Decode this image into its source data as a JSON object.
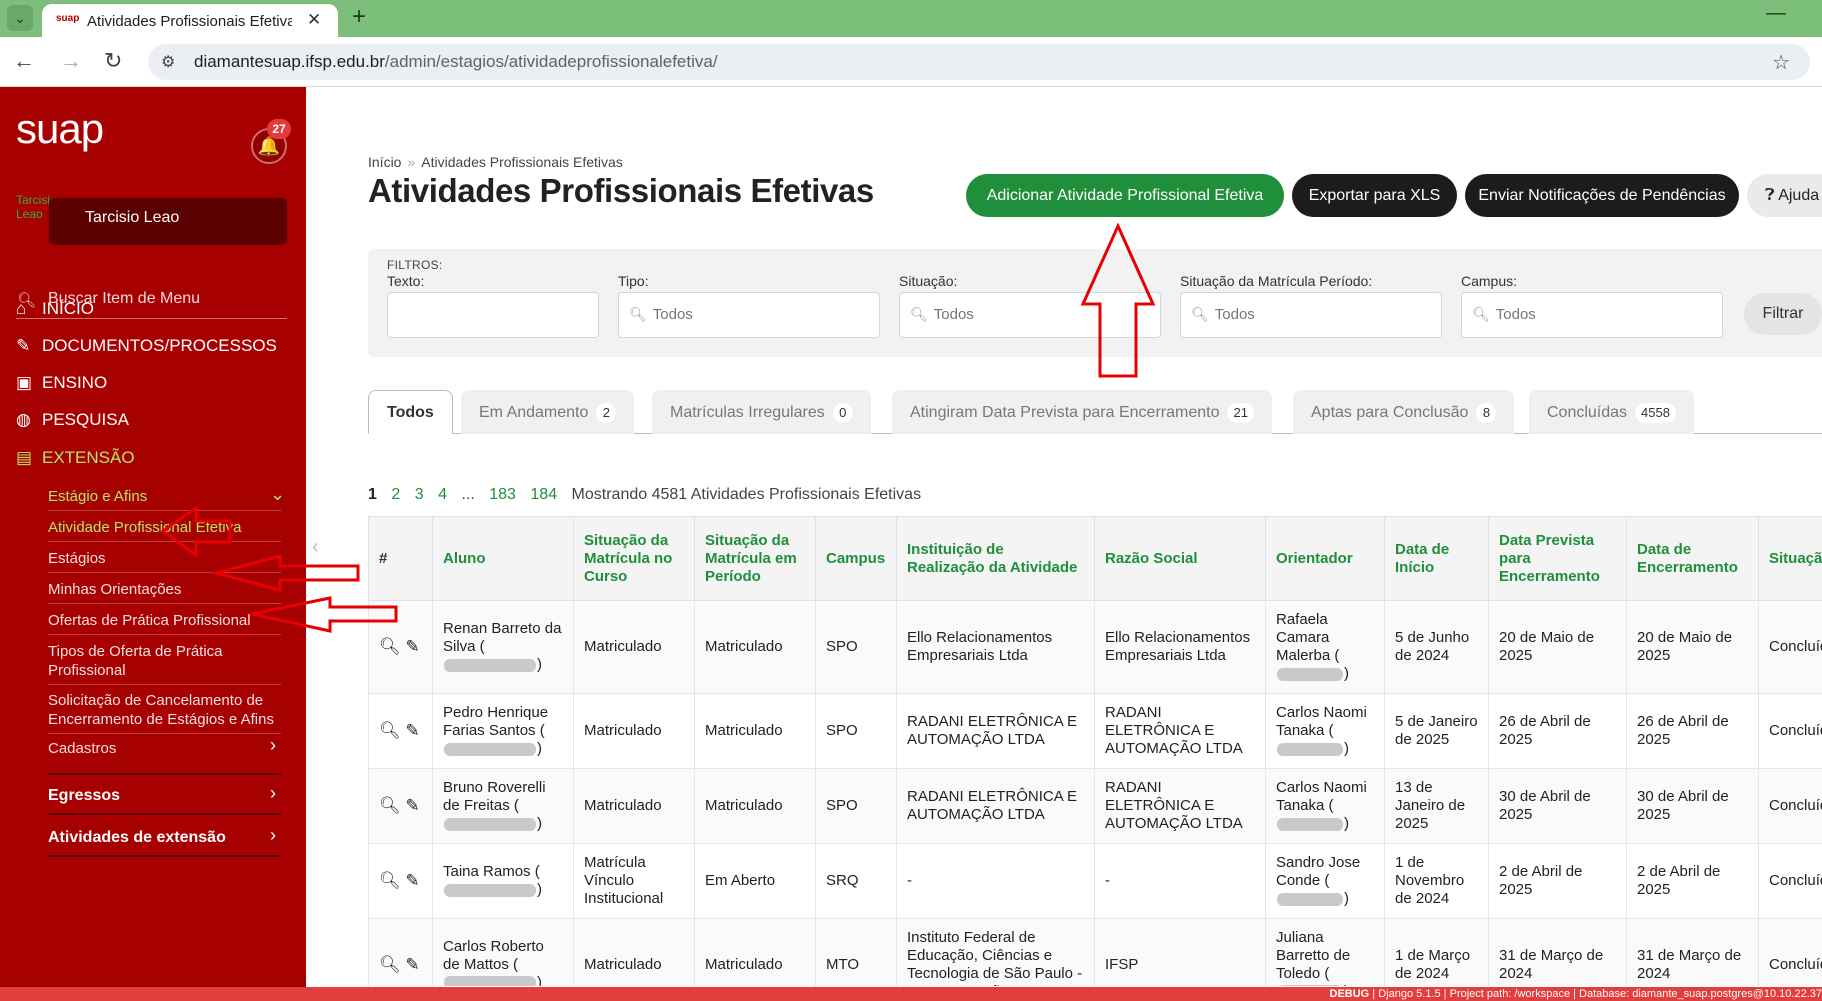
{
  "browser": {
    "tab_title": "Atividades Profissionais Efetivas",
    "tab_favicon_text": "suap",
    "url_host": "diamantesuap.ifsp.edu.br",
    "url_path": "/admin/estagios/atividadeprofissionalefetiva/"
  },
  "sidebar": {
    "logo": "suap",
    "notifications_count": "27",
    "user_name": "Tarcisio Leao",
    "avatar_alt": "Tarcisio Leao",
    "search_placeholder": "Buscar Item de Menu",
    "menu": [
      {
        "label": "INÍCIO",
        "icon": "home-icon"
      },
      {
        "label": "DOCUMENTOS/PROCESSOS",
        "icon": "document-edit-icon"
      },
      {
        "label": "ENSINO",
        "icon": "teacher-icon"
      },
      {
        "label": "PESQUISA",
        "icon": "globe-icon"
      },
      {
        "label": "EXTENSÃO",
        "icon": "briefcase-icon"
      }
    ],
    "submenu_group": "Estágio e Afins",
    "submenu": [
      "Atividade Profissional Efetiva",
      "Estágios",
      "Minhas Orientações",
      "Ofertas de Prática Profissional",
      "Tipos de Oferta de Prática Profissional",
      "Solicitação de Cancelamento de Encerramento de Estágios e Afins",
      "Cadastros"
    ],
    "sections": [
      "Egressos",
      "Atividades de extensão"
    ]
  },
  "main": {
    "breadcrumb": [
      "Início",
      "Atividades Profissionais Efetivas"
    ],
    "title": "Atividades Profissionais Efetivas",
    "buttons": {
      "add": "Adicionar Atividade Profissional Efetiva",
      "export": "Exportar para XLS",
      "notify": "Enviar Notificações de Pendências",
      "help": "Ajuda"
    },
    "filters": {
      "title": "FILTROS:",
      "texto_label": "Texto:",
      "tipo_label": "Tipo:",
      "situacao_label": "Situação:",
      "situacao_matricula_label": "Situação da Matrícula Período:",
      "campus_label": "Campus:",
      "all": "Todos",
      "submit": "Filtrar"
    },
    "tabs": [
      {
        "label": "Todos",
        "count": ""
      },
      {
        "label": "Em Andamento",
        "count": "2"
      },
      {
        "label": "Matrículas Irregulares",
        "count": "0"
      },
      {
        "label": "Atingiram Data Prevista para Encerramento",
        "count": "21"
      },
      {
        "label": "Aptas para Conclusão",
        "count": "8"
      },
      {
        "label": "Concluídas",
        "count": "4558"
      }
    ],
    "pagination": {
      "current": "1",
      "pages": [
        "2",
        "3",
        "4"
      ],
      "ellipsis": "...",
      "last_pages": [
        "183",
        "184"
      ],
      "summary": "Mostrando 4581 Atividades Profissionais Efetivas"
    },
    "table": {
      "headers": [
        "#",
        "Aluno",
        "Situação da Matrícula no Curso",
        "Situação da Matrícula em Período",
        "Campus",
        "Instituição de Realização da Atividade",
        "Razão Social",
        "Orientador",
        "Data de Início",
        "Data Prevista para Encerramento",
        "Data de Encerramento",
        "Situação"
      ],
      "rows": [
        {
          "aluno": "Renan Barreto da Silva",
          "sit_curso": "Matriculado",
          "sit_periodo": "Matriculado",
          "campus": "SPO",
          "instituicao": "Ello Relacionamentos Empresariais Ltda",
          "razao": "Ello Relacionamentos Empresariais Ltda",
          "orientador": "Rafaela Camara Malerba",
          "inicio": "5 de Junho de 2024",
          "prevista": "20 de Maio de 2025",
          "encerramento": "20 de Maio de 2025",
          "situacao": "Concluída"
        },
        {
          "aluno": "Pedro Henrique Farias Santos",
          "sit_curso": "Matriculado",
          "sit_periodo": "Matriculado",
          "campus": "SPO",
          "instituicao": "RADANI ELETRÔNICA E AUTOMAÇÃO LTDA",
          "razao": "RADANI ELETRÔNICA E AUTOMAÇÃO LTDA",
          "orientador": "Carlos Naomi Tanaka",
          "inicio": "5 de Janeiro de 2025",
          "prevista": "26 de Abril de 2025",
          "encerramento": "26 de Abril de 2025",
          "situacao": "Concluída"
        },
        {
          "aluno": "Bruno Roverelli de Freitas",
          "sit_curso": "Matriculado",
          "sit_periodo": "Matriculado",
          "campus": "SPO",
          "instituicao": "RADANI ELETRÔNICA E AUTOMAÇÃO LTDA",
          "razao": "RADANI ELETRÔNICA E AUTOMAÇÃO LTDA",
          "orientador": "Carlos Naomi Tanaka",
          "inicio": "13 de Janeiro de 2025",
          "prevista": "30 de Abril de 2025",
          "encerramento": "30 de Abril de 2025",
          "situacao": "Concluída"
        },
        {
          "aluno": "Taina Ramos",
          "sit_curso": "Matrícula Vínculo Institucional",
          "sit_periodo": "Em Aberto",
          "campus": "SRQ",
          "instituicao": "-",
          "razao": "-",
          "orientador": "Sandro Jose Conde",
          "inicio": "1 de Novembro de 2024",
          "prevista": "2 de Abril de 2025",
          "encerramento": "2 de Abril de 2025",
          "situacao": "Concluída"
        },
        {
          "aluno": "Carlos Roberto de Mattos",
          "sit_curso": "Matriculado",
          "sit_periodo": "Matriculado",
          "campus": "MTO",
          "instituicao": "Instituto Federal de Educação, Ciências e Tecnologia de São Paulo - Campus Matão",
          "razao": "IFSP",
          "orientador": "Juliana Barretto de Toledo",
          "inicio": "1 de Março de 2024",
          "prevista": "31 de Março de 2024",
          "encerramento": "31 de Março de 2024",
          "situacao": "Concluída"
        }
      ]
    }
  },
  "debug": {
    "label": "DEBUG",
    "django": "Django 5.1.5",
    "project": "Project path: /workspace",
    "database": "Database: diamante_suap.postgres@10.10.22.37"
  },
  "colors": {
    "sidebar": "#a70000",
    "accent_green": "#1f8f3b",
    "menu_active": "#b7e36a",
    "annotation_red": "#e60000"
  }
}
